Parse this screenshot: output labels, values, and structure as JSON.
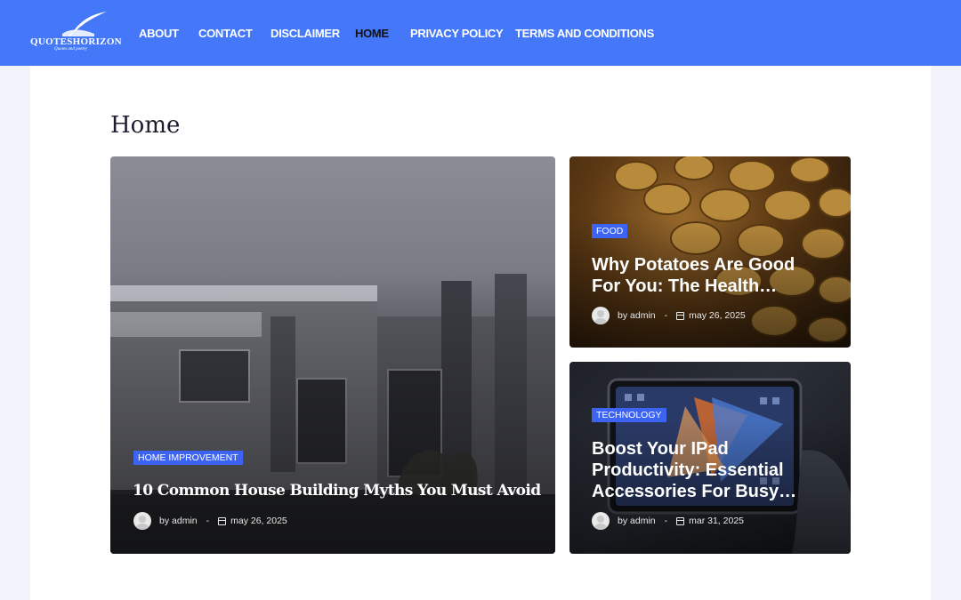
{
  "header": {
    "logo": {
      "name": "QUOTESHORIZON",
      "tagline": "Quotes and poetry"
    },
    "nav": [
      {
        "label": "ABOUT",
        "active": false
      },
      {
        "label": "CONTACT",
        "active": false
      },
      {
        "label": "DISCLAIMER",
        "active": false
      },
      {
        "label": "HOME",
        "active": true
      },
      {
        "label": "PRIVACY POLICY",
        "active": false
      },
      {
        "label": "TERMS AND CONDITIONS",
        "active": false
      }
    ]
  },
  "page": {
    "title": "Home"
  },
  "posts": [
    {
      "category": "HOME IMPROVEMENT",
      "title": "10 Common House Building Myths You  Must Avoid",
      "author_prefix": "by",
      "author": "admin",
      "separator": "-",
      "date": "may 26, 2025"
    },
    {
      "category": "FOOD",
      "title": "Why Potatoes Are Good For You: The Health…",
      "author_prefix": "by",
      "author": "admin",
      "separator": "-",
      "date": "may 26, 2025"
    },
    {
      "category": "TECHNOLOGY",
      "title": "Boost Your IPad Productivity: Essential Accessories For Busy…",
      "author_prefix": "by",
      "author": "admin",
      "separator": "-",
      "date": "mar 31, 2025"
    }
  ],
  "colors": {
    "header_bg": "#4478f8",
    "badge_bg": "#3d63f2",
    "page_bg": "#f3f3fb",
    "active_nav": "#111111"
  }
}
